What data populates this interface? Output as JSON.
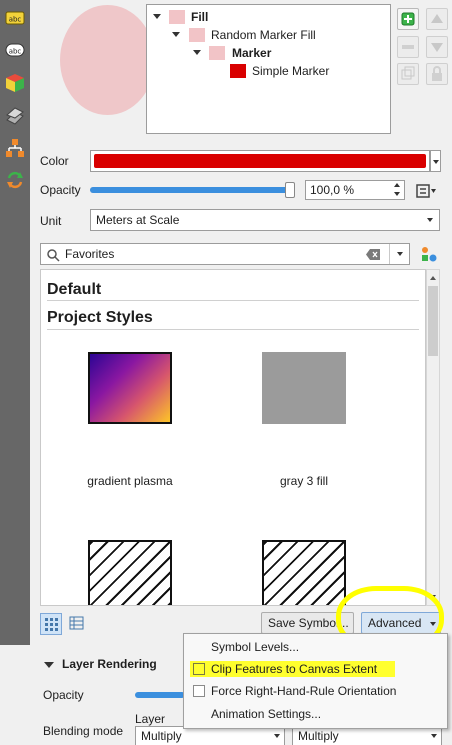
{
  "colors": {
    "accent": "#3b8fde",
    "color_value": "#d90000",
    "preview": "#efc7c9",
    "highlight": "#ffff2e"
  },
  "rail": {
    "icons": [
      "abc-label-icon",
      "abc-text-icon",
      "3d-cube-icon",
      "layers-icon",
      "diagram-icon",
      "refresh-icon"
    ],
    "badge_text": "abc",
    "badge_text_2": "abc"
  },
  "tree": {
    "fill": "Fill",
    "random_marker_fill": "Random Marker Fill",
    "marker": "Marker",
    "simple_marker": "Simple Marker"
  },
  "properties": {
    "color_label": "Color",
    "opacity_label": "Opacity",
    "opacity_value": "100,0 %",
    "opacity_fraction": 1.0,
    "unit_label": "Unit",
    "unit_value": "Meters at Scale"
  },
  "search": {
    "value": "Favorites"
  },
  "library": {
    "section_default": "Default",
    "section_project": "Project Styles",
    "items": [
      {
        "label": "gradient   plasma"
      },
      {
        "label": "gray 3 fill"
      }
    ]
  },
  "toolbar": {
    "save_symbol": "Save Symbol...",
    "advanced": "Advanced"
  },
  "layer_rendering": {
    "title": "Layer Rendering",
    "opacity_label": "Opacity",
    "blending_label": "Blending mode",
    "layer_label": "Layer",
    "blend_layer_value": "Multiply",
    "blend_feature_value": "Multiply"
  },
  "advanced_menu": {
    "items": [
      "Symbol Levels...",
      "Clip Features to Canvas Extent",
      "Force Right-Hand-Rule Orientation",
      "Animation Settings..."
    ]
  }
}
